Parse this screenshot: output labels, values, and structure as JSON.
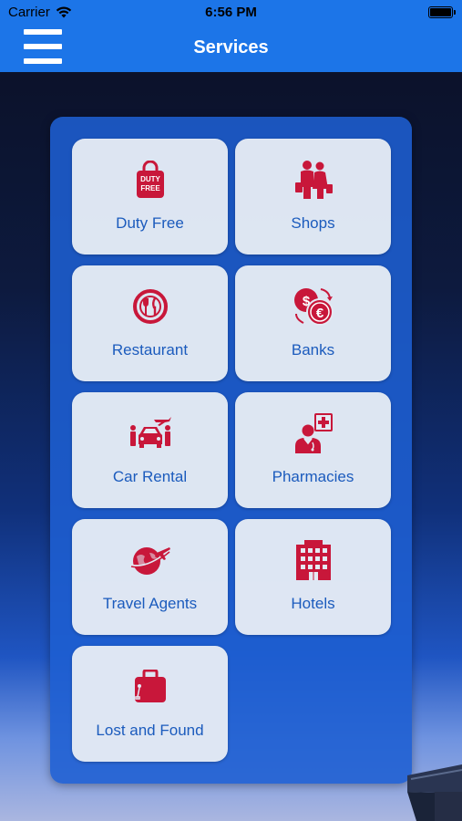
{
  "status_bar": {
    "carrier": "Carrier",
    "time": "6:56 PM"
  },
  "navbar": {
    "title": "Services"
  },
  "theme": {
    "accent": "#1c75e8",
    "icon_color": "#c8173a",
    "label_color": "#1b5bbd"
  },
  "services": [
    {
      "label": "Duty Free",
      "icon": "duty-free-bag-icon",
      "icon_text": [
        "DUTY",
        "FREE"
      ]
    },
    {
      "label": "Shops",
      "icon": "shoppers-icon"
    },
    {
      "label": "Restaurant",
      "icon": "plate-cutlery-icon"
    },
    {
      "label": "Banks",
      "icon": "currency-exchange-icon",
      "icon_text": [
        "$",
        "€"
      ]
    },
    {
      "label": "Car Rental",
      "icon": "car-rental-icon"
    },
    {
      "label": "Pharmacies",
      "icon": "pharmacist-icon"
    },
    {
      "label": "Travel Agents",
      "icon": "globe-plane-icon"
    },
    {
      "label": "Hotels",
      "icon": "hotel-building-icon"
    },
    {
      "label": "Lost and Found",
      "icon": "suitcase-icon"
    }
  ]
}
